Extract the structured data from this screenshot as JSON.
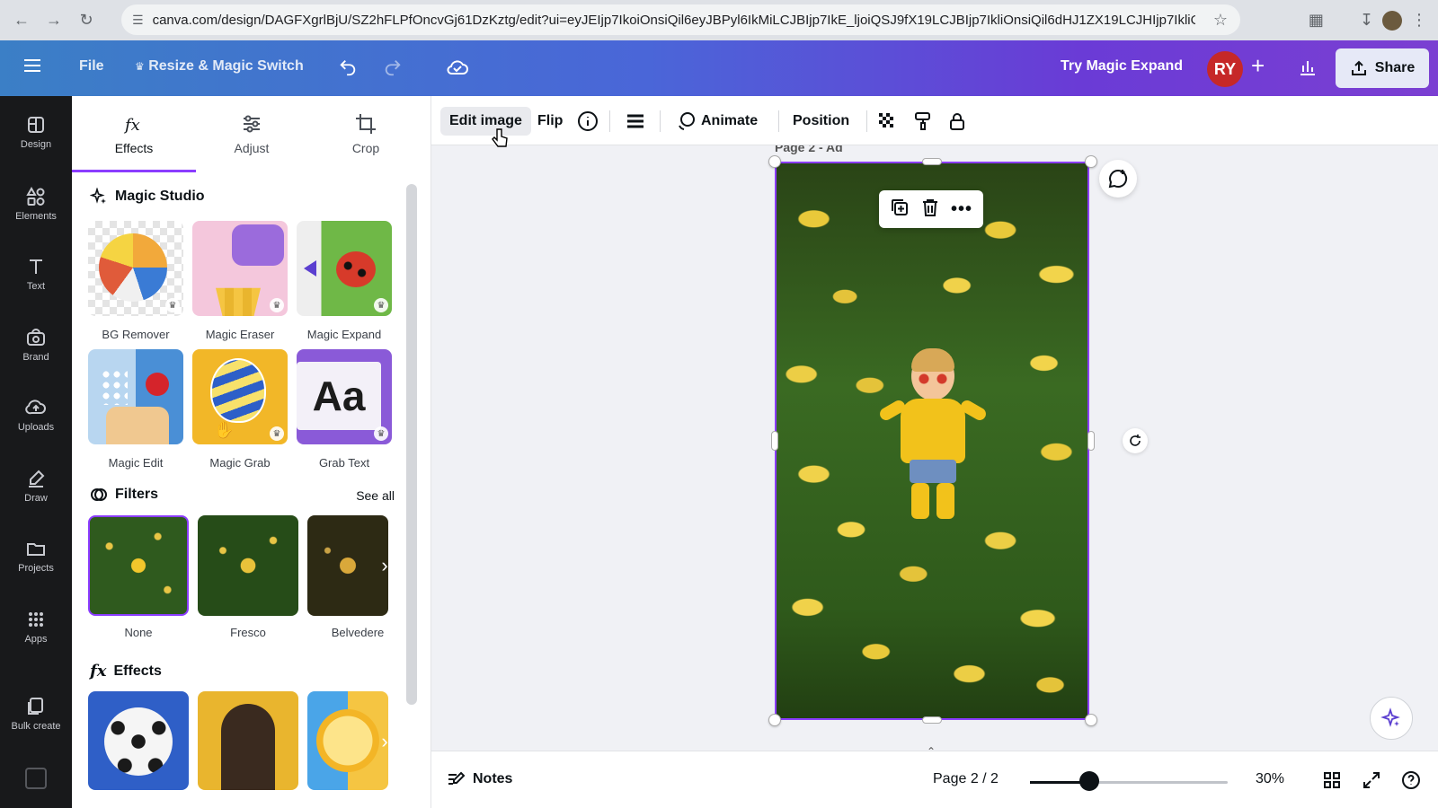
{
  "browser": {
    "url": "canva.com/design/DAGFXgrlBjU/SZ2hFLPfOncvGj61DzKztg/edit?ui=eyJEIjp7IkoiOnsiQil6eyJBPyl6IkMiLCJBIjp7IkE_ljoiQSJ9fX19LCJBIjp7IkliOnsiQil6dHJ1ZX19LCJHIjp7IkliOnR..."
  },
  "header": {
    "file_label": "File",
    "resize_label": "Resize & Magic Switch",
    "try_magic_label": "Try Magic Expand",
    "avatar_initials": "RY",
    "share_label": "Share"
  },
  "rail": {
    "items": [
      {
        "label": "Design",
        "icon": "design-icon"
      },
      {
        "label": "Elements",
        "icon": "elements-icon"
      },
      {
        "label": "Text",
        "icon": "text-icon"
      },
      {
        "label": "Brand",
        "icon": "brand-icon"
      },
      {
        "label": "Uploads",
        "icon": "uploads-icon"
      },
      {
        "label": "Draw",
        "icon": "draw-icon"
      },
      {
        "label": "Projects",
        "icon": "projects-icon"
      },
      {
        "label": "Apps",
        "icon": "apps-icon"
      },
      {
        "label": "Bulk create",
        "icon": "bulk-create-icon"
      }
    ]
  },
  "panel": {
    "tabs": [
      {
        "label": "Effects"
      },
      {
        "label": "Adjust"
      },
      {
        "label": "Crop"
      }
    ],
    "magic_studio": {
      "title": "Magic Studio",
      "tools": [
        {
          "label": "BG Remover"
        },
        {
          "label": "Magic Eraser"
        },
        {
          "label": "Magic Expand"
        },
        {
          "label": "Magic Edit"
        },
        {
          "label": "Magic Grab"
        },
        {
          "label": "Grab Text"
        }
      ]
    },
    "filters": {
      "title": "Filters",
      "see_all": "See all",
      "items": [
        {
          "label": "None"
        },
        {
          "label": "Fresco"
        },
        {
          "label": "Belvedere"
        }
      ]
    },
    "effects": {
      "title": "Effects"
    }
  },
  "context_toolbar": {
    "edit_image": "Edit image",
    "flip": "Flip",
    "animate": "Animate",
    "position": "Position"
  },
  "canvas": {
    "page_label": "Page 2 - Ad"
  },
  "footer": {
    "notes": "Notes",
    "page_count": "Page 2 / 2",
    "zoom": "30%",
    "zoom_level": 0.3
  },
  "colors": {
    "accent": "#8b3dff",
    "rail_bg": "#18191b",
    "avatar_bg": "#c62828"
  }
}
